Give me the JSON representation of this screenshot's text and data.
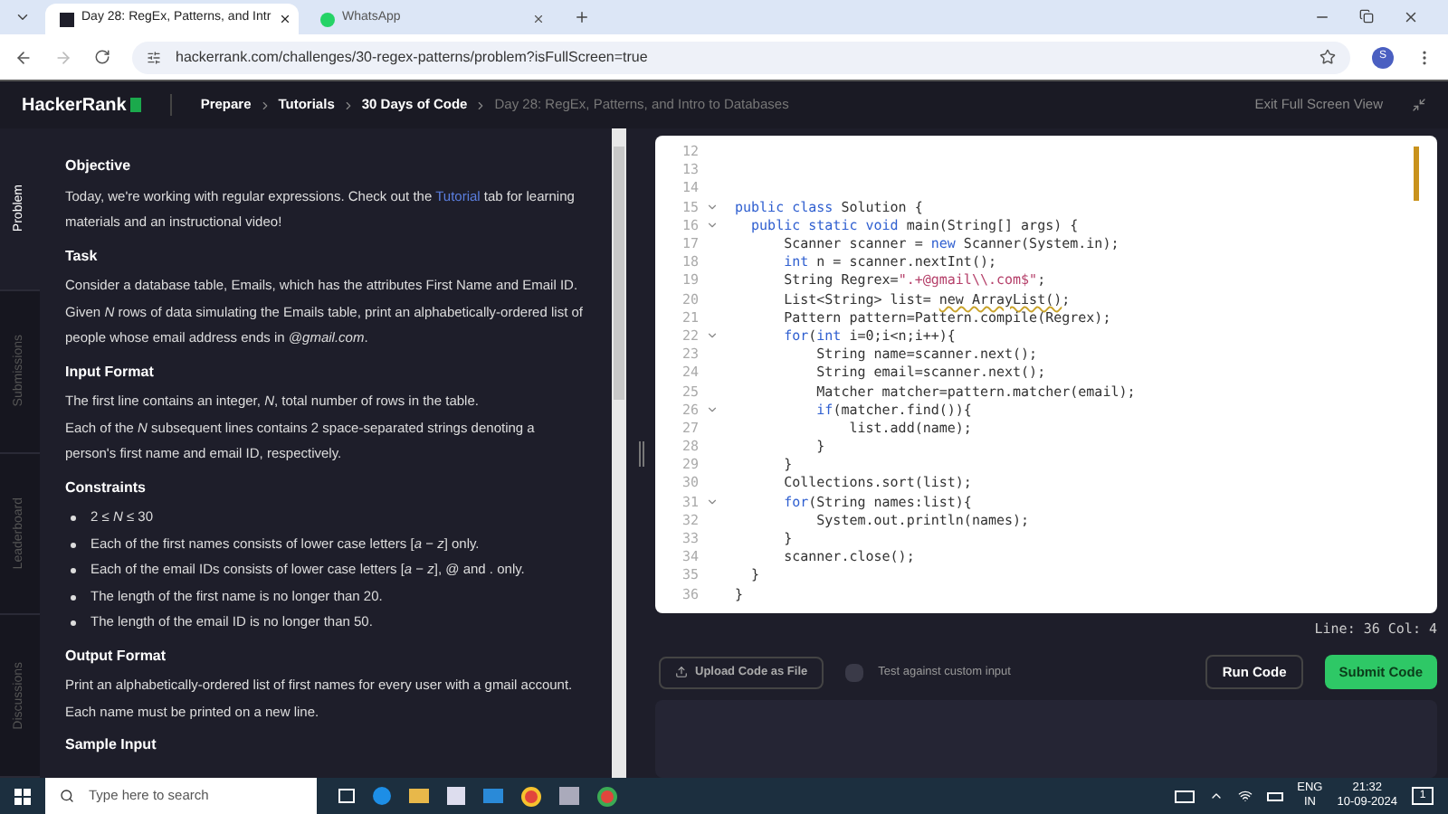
{
  "browser": {
    "tabs": [
      {
        "title": "Day 28: RegEx, Patterns, and Intr",
        "selected": true,
        "kind": "hackerrank"
      },
      {
        "title": "WhatsApp",
        "selected": false,
        "kind": "whatsapp"
      }
    ],
    "url": "hackerrank.com/challenges/30-regex-patterns/problem?isFullScreen=true",
    "profile": "S"
  },
  "header": {
    "logo": "HackerRank",
    "breadcrumbs": [
      {
        "label": "Prepare",
        "current": false
      },
      {
        "label": "Tutorials",
        "current": false
      },
      {
        "label": "30 Days of Code",
        "current": false
      },
      {
        "label": "Day 28: RegEx, Patterns, and Intro to Databases",
        "current": true
      }
    ],
    "exit": "Exit Full Screen View"
  },
  "side_tabs": [
    {
      "label": "Problem",
      "selected": true
    },
    {
      "label": "Submissions",
      "selected": false
    },
    {
      "label": "Leaderboard",
      "selected": false
    },
    {
      "label": "Discussions",
      "selected": false
    }
  ],
  "problem": [
    {
      "kind": "heading",
      "text": "Objective"
    },
    {
      "kind": "para",
      "text": "Today, we're working with regular expressions. Check out the ",
      "link": "Tutorial",
      "after": " tab for learning materials and an instructional video!"
    },
    {
      "kind": "heading",
      "text": "Task"
    },
    {
      "kind": "para",
      "text": "Consider a database table, Emails, which has the attributes First Name and Email ID. Given *N* rows of data simulating the Emails table, print an alphabetically-ordered list of people whose email address ends in *@gmail.com*."
    },
    {
      "kind": "heading",
      "text": "Input Format"
    },
    {
      "kind": "para",
      "text": "The first line contains an integer, *N*, total number of rows in the table."
    },
    {
      "kind": "para",
      "text": "Each of the *N* subsequent lines contains 2 space-separated strings denoting a person's first name and email ID, respectively."
    },
    {
      "kind": "heading",
      "text": "Constraints"
    },
    {
      "kind": "bullet",
      "text": "2 ≤ *N* ≤ 30"
    },
    {
      "kind": "bullet",
      "text": "Each of the first names consists of lower case letters [*a* − *z*] only."
    },
    {
      "kind": "bullet",
      "text": "Each of the email IDs consists of lower case letters [*a* − *z*], @ and . only."
    },
    {
      "kind": "bullet",
      "text": "The length of the first name is no longer than 20."
    },
    {
      "kind": "bullet",
      "text": "The length of the email ID is no longer than 50."
    },
    {
      "kind": "heading",
      "text": "Output Format"
    },
    {
      "kind": "para",
      "text": "Print an alphabetically-ordered list of first names for every user with a gmail account."
    },
    {
      "kind": "para",
      "text": "Each name must be printed on a new line."
    },
    {
      "kind": "heading",
      "text": "Sample Input"
    }
  ],
  "editor": {
    "lines": [
      {
        "num": "12",
        "fold": false
      },
      {
        "num": "13",
        "fold": false
      },
      {
        "num": "14",
        "fold": false
      },
      {
        "num": "15",
        "fold": true,
        "tokens": [
          {
            "kind": "kw",
            "text": "public class"
          },
          {
            "kind": "plain",
            "text": " Solution {"
          }
        ]
      },
      {
        "num": "16",
        "fold": true,
        "tokens": [
          {
            "kind": "kw",
            "text": "  public static void"
          },
          {
            "kind": "plain",
            "text": " main(String[] args) {"
          }
        ]
      },
      {
        "num": "17",
        "fold": false,
        "tokens": [
          {
            "kind": "plain",
            "text": "      Scanner scanner = "
          },
          {
            "kind": "kw",
            "text": "new"
          },
          {
            "kind": "plain",
            "text": " Scanner(System.in);"
          }
        ]
      },
      {
        "num": "18",
        "fold": false,
        "tokens": [
          {
            "kind": "kw",
            "text": "      int"
          },
          {
            "kind": "plain",
            "text": " n = scanner.nextInt();"
          }
        ]
      },
      {
        "num": "19",
        "fold": false,
        "tokens": [
          {
            "kind": "plain",
            "text": "      String Regrex="
          },
          {
            "kind": "str",
            "text": "\".+@gmail\\\\.com$\""
          },
          {
            "kind": "plain",
            "text": ";"
          }
        ]
      },
      {
        "num": "20",
        "fold": false,
        "tokens": [
          {
            "kind": "plain",
            "text": "      List<String> list= "
          },
          {
            "kind": "warn",
            "text": "new ArrayList()"
          },
          {
            "kind": "plain",
            "text": ";"
          }
        ]
      },
      {
        "num": "21",
        "fold": false,
        "tokens": [
          {
            "kind": "plain",
            "text": "      Pattern pattern=Pattern.compile(Regrex);"
          }
        ]
      },
      {
        "num": "22",
        "fold": true,
        "tokens": [
          {
            "kind": "kw",
            "text": "      for"
          },
          {
            "kind": "plain",
            "text": "("
          },
          {
            "kind": "kw",
            "text": "int"
          },
          {
            "kind": "plain",
            "text": " i=0;i<n;i++){"
          }
        ]
      },
      {
        "num": "23",
        "fold": false,
        "tokens": [
          {
            "kind": "plain",
            "text": "          String name=scanner.next();"
          }
        ]
      },
      {
        "num": "24",
        "fold": false,
        "tokens": [
          {
            "kind": "plain",
            "text": "          String email=scanner.next();"
          }
        ]
      },
      {
        "num": "25",
        "fold": false,
        "tokens": [
          {
            "kind": "plain",
            "text": "          Matcher matcher=pattern.matcher(email);"
          }
        ]
      },
      {
        "num": "26",
        "fold": true,
        "tokens": [
          {
            "kind": "kw",
            "text": "          if"
          },
          {
            "kind": "plain",
            "text": "(matcher.find()){"
          }
        ]
      },
      {
        "num": "27",
        "fold": false,
        "tokens": [
          {
            "kind": "plain",
            "text": "              list.add(name);"
          }
        ]
      },
      {
        "num": "28",
        "fold": false,
        "tokens": [
          {
            "kind": "plain",
            "text": "          }"
          }
        ]
      },
      {
        "num": "29",
        "fold": false,
        "tokens": [
          {
            "kind": "plain",
            "text": "      }"
          }
        ]
      },
      {
        "num": "30",
        "fold": false,
        "tokens": [
          {
            "kind": "plain",
            "text": "      Collections.sort(list);"
          }
        ]
      },
      {
        "num": "31",
        "fold": true,
        "tokens": [
          {
            "kind": "kw",
            "text": "      for"
          },
          {
            "kind": "plain",
            "text": "(String names:list){"
          }
        ]
      },
      {
        "num": "32",
        "fold": false,
        "tokens": [
          {
            "kind": "plain",
            "text": "          System.out.println(names);"
          }
        ]
      },
      {
        "num": "33",
        "fold": false,
        "tokens": [
          {
            "kind": "plain",
            "text": "      }"
          }
        ]
      },
      {
        "num": "34",
        "fold": false,
        "tokens": [
          {
            "kind": "plain",
            "text": "      scanner.close();"
          }
        ]
      },
      {
        "num": "35",
        "fold": false,
        "tokens": [
          {
            "kind": "plain",
            "text": "  }"
          }
        ]
      },
      {
        "num": "36",
        "fold": false,
        "tokens": [
          {
            "kind": "plain",
            "text": "}"
          }
        ]
      }
    ],
    "status": "Line: 36 Col: 4"
  },
  "actions": {
    "upload": "Upload Code as File",
    "custom_input": {
      "label": "Test against custom input",
      "checked": false
    },
    "run": "Run Code",
    "submit": "Submit Code"
  },
  "taskbar": {
    "search_placeholder": "Type here to search",
    "lang": "ENG",
    "region": "IN",
    "time": "21:32",
    "date": "10-09-2024",
    "notifications": "1"
  }
}
